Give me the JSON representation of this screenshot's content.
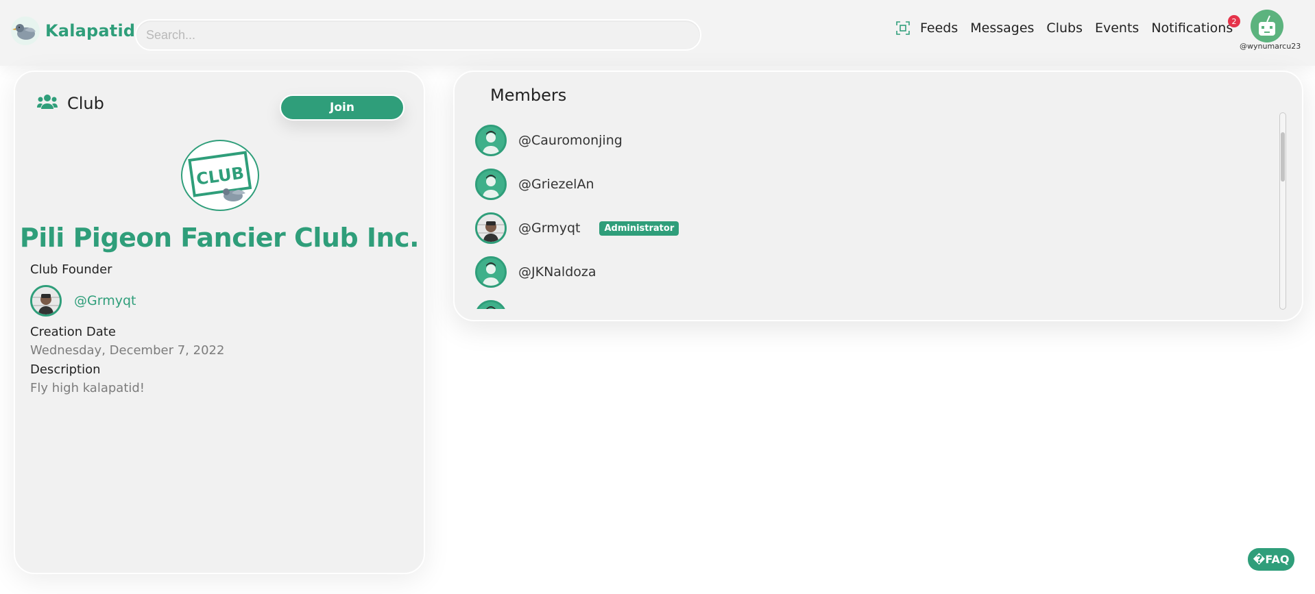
{
  "header": {
    "brand": "Kalapatid",
    "search_placeholder": "Search...",
    "nav": {
      "scan_icon": "qr-scan-icon",
      "feeds": "Feeds",
      "messages": "Messages",
      "clubs": "Clubs",
      "events": "Events",
      "notifications": "Notifications",
      "notification_count": "2"
    },
    "user_handle": "@wynumarcu23"
  },
  "club": {
    "section_title": "Club",
    "join_label": "Join",
    "logo_text": "CLUB",
    "name": "Pili Pigeon Fancier Club Inc.",
    "founder_label": "Club Founder",
    "founder_handle": "@Grmyqt",
    "creation_label": "Creation Date",
    "creation_value": "Wednesday, December 7, 2022",
    "description_label": "Description",
    "description_value": "Fly high kalapatid!"
  },
  "members": {
    "title": "Members",
    "items": [
      {
        "handle": "@Cauromonjing",
        "badge": ""
      },
      {
        "handle": "@GriezelAn",
        "badge": ""
      },
      {
        "handle": "@Grmyqt",
        "badge": "Administrator"
      },
      {
        "handle": "@JKNaldoza",
        "badge": ""
      }
    ]
  },
  "faq_label": "�FAQ",
  "colors": {
    "accent": "#2f9e7a",
    "badge_red": "#e5334a",
    "card_bg": "#f1f1f1"
  }
}
